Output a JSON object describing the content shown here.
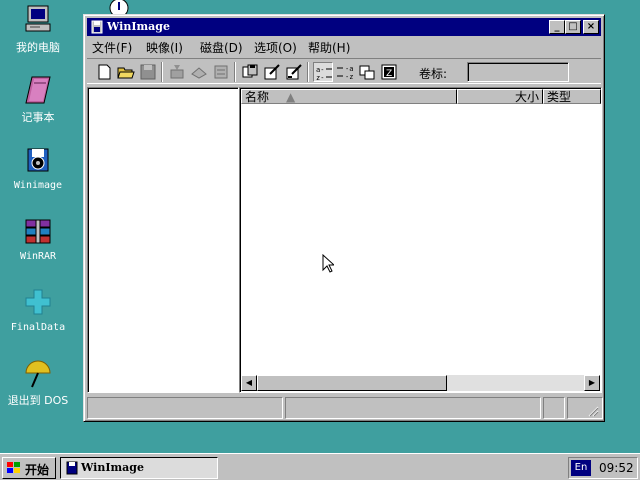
{
  "desktop": {
    "icons": [
      {
        "label": "我的电脑",
        "icon": "my-computer-icon"
      },
      {
        "label": "记事本",
        "icon": "notepad-icon"
      },
      {
        "label": "Winimage",
        "icon": "winimage-icon"
      },
      {
        "label": "WinRAR",
        "icon": "winrar-icon"
      },
      {
        "label": "FinalData",
        "icon": "finaldata-icon"
      },
      {
        "label": "退出到 DOS",
        "icon": "exit-dos-icon"
      }
    ]
  },
  "window": {
    "title": "WinImage",
    "menu": [
      "文件(F)",
      "映像(I)",
      "磁盘(D)",
      "选项(O)",
      "帮助(H)"
    ],
    "volume_label": "卷标:",
    "volume_value": "",
    "columns": {
      "name": "名称",
      "size": "大小",
      "type": "类型"
    }
  },
  "taskbar": {
    "start_label": "开始",
    "task_label": "WinImage",
    "language": "En",
    "clock": "09:52"
  },
  "colors": {
    "desktop": "#3f9f9f",
    "titlebar": "#000080",
    "face": "#c0c0c0"
  }
}
